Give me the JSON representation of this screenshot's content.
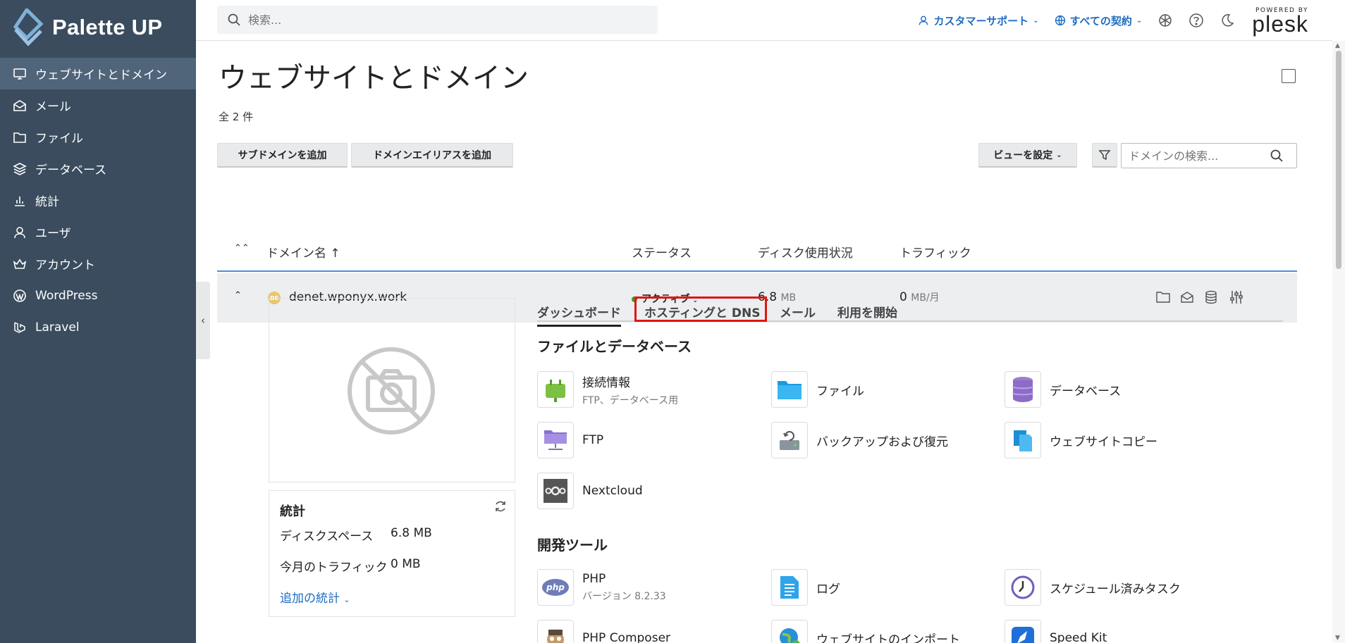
{
  "brand": {
    "name": "Palette UP"
  },
  "sidebar": {
    "items": [
      {
        "label": "ウェブサイトとドメイン",
        "icon": "monitor-icon",
        "active": true
      },
      {
        "label": "メール",
        "icon": "mail-icon"
      },
      {
        "label": "ファイル",
        "icon": "folder-icon"
      },
      {
        "label": "データベース",
        "icon": "layers-icon"
      },
      {
        "label": "統計",
        "icon": "chart-icon"
      },
      {
        "label": "ユーザ",
        "icon": "user-icon"
      },
      {
        "label": "アカウント",
        "icon": "crown-icon"
      },
      {
        "label": "WordPress",
        "icon": "wordpress-icon"
      },
      {
        "label": "Laravel",
        "icon": "laravel-icon"
      }
    ]
  },
  "topbar": {
    "search_placeholder": "検索...",
    "support": "カスタマーサポート",
    "subscriptions": "すべての契約",
    "powered_by": "POWERED BY",
    "plesk": "plesk"
  },
  "page": {
    "title": "ウェブサイトとドメイン",
    "count": "全 2 件",
    "add_subdomain": "サブドメインを追加",
    "add_alias": "ドメインエイリアスを追加",
    "view_settings": "ビューを設定",
    "domain_search_placeholder": "ドメインの検索..."
  },
  "table": {
    "headers": {
      "name": "ドメイン名 ↑",
      "status": "ステータス",
      "disk": "ディスク使用状況",
      "traffic": "トラフィック"
    },
    "row": {
      "badge": "DE",
      "domain": "denet.wponyx.work",
      "status": "アクティブ",
      "disk_value": "6.8",
      "disk_unit": "MB",
      "traffic_value": "0",
      "traffic_unit": "MB/月"
    }
  },
  "stats": {
    "title": "統計",
    "disk_label": "ディスクスペース",
    "disk_value": "6.8 MB",
    "traffic_label": "今月のトラフィック",
    "traffic_value": "0 MB",
    "more": "追加の統計"
  },
  "tabs": [
    "ダッシュボード",
    "ホスティングと DNS",
    "メール",
    "利用を開始"
  ],
  "sections": {
    "files": "ファイルとデータベース",
    "dev": "開発ツール"
  },
  "tools": {
    "connection": {
      "title": "接続情報",
      "sub": "FTP、データベース用"
    },
    "files": {
      "title": "ファイル"
    },
    "databases": {
      "title": "データベース"
    },
    "ftp": {
      "title": "FTP"
    },
    "backup": {
      "title": "バックアップおよび復元"
    },
    "copy": {
      "title": "ウェブサイトコピー"
    },
    "nextcloud": {
      "title": "Nextcloud"
    },
    "php": {
      "title": "PHP",
      "sub": "バージョン 8.2.33"
    },
    "logs": {
      "title": "ログ"
    },
    "scheduled": {
      "title": "スケジュール済みタスク"
    },
    "composer": {
      "title": "PHP Composer"
    },
    "import": {
      "title": "ウェブサイトのインポート"
    },
    "speedkit": {
      "title": "Speed Kit"
    }
  },
  "colors": {
    "sidebar": "#3a4c5e",
    "accent": "#1f6cc2",
    "highlight": "#e01616",
    "active_status": "#3c9a2c"
  }
}
